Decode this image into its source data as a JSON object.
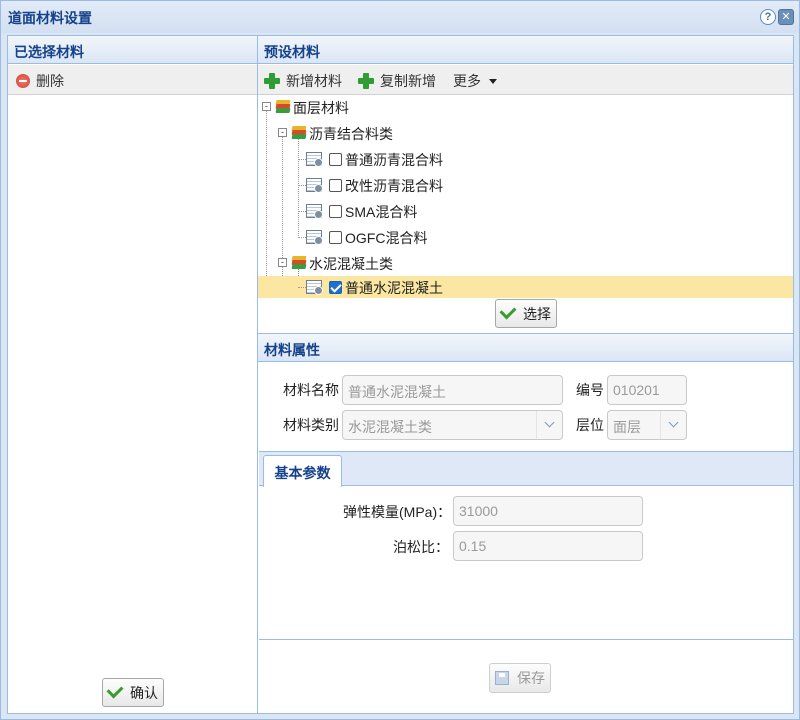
{
  "window": {
    "title": "道面材料设置",
    "help_symbol": "?",
    "close_symbol": "✕"
  },
  "left_panel": {
    "title": "已选择材料",
    "delete_label": "删除",
    "confirm_label": "确认"
  },
  "preset_panel": {
    "title": "预设材料",
    "toolbar": {
      "add_label": "新增材料",
      "copy_add_label": "复制新增",
      "more_label": "更多"
    },
    "tree": {
      "root": "面层材料",
      "group1": "沥青结合料类",
      "group1_items": [
        "普通沥青混合料",
        "改性沥青混合料",
        "SMA混合料",
        "OGFC混合料"
      ],
      "group2": "水泥混凝土类",
      "group2_items": [
        "普通水泥混凝土"
      ],
      "checked_item": "普通水泥混凝土"
    },
    "select_label": "选择"
  },
  "props_panel": {
    "title": "材料属性",
    "name_label": "材料名称",
    "name_value": "普通水泥混凝土",
    "code_label": "编号",
    "code_value": "010201",
    "category_label": "材料类别",
    "category_value": "水泥混凝土类",
    "layer_label": "层位",
    "layer_value": "面层",
    "tab_basic": "基本参数",
    "modulus_label": "弹性模量(MPa)：",
    "modulus_value": "31000",
    "poisson_label": "泊松比：",
    "poisson_value": "0.15",
    "save_label": "保存"
  },
  "colors": {
    "header_text": "#15428b",
    "border": "#99bbe8",
    "selected_row": "#fbe7a1",
    "add_icon": "#2f9d34",
    "delete_icon": "#d33c2c"
  },
  "icons": {
    "delete": "minus-circle-icon",
    "add": "plus-icon",
    "copy_add": "plus-icon",
    "layers": "layers-icon",
    "material": "sheet-gear-icon",
    "confirm": "check-icon",
    "save": "save-icon"
  }
}
